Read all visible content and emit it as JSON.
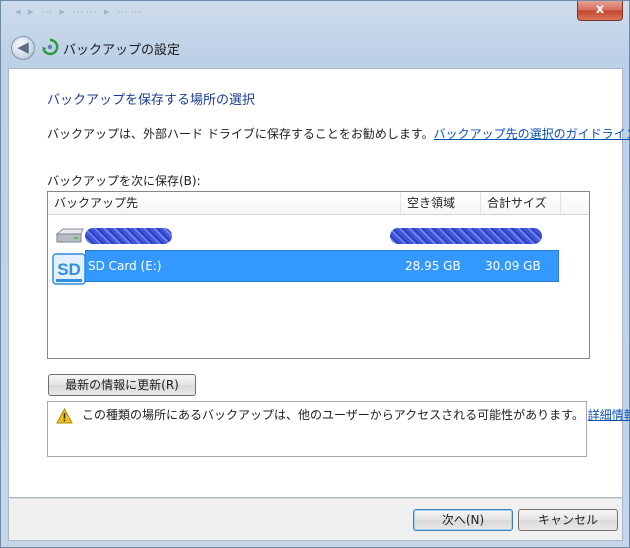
{
  "window": {
    "title": "バックアップの設定",
    "close_glyph": "x",
    "back_glyph": "◀"
  },
  "content": {
    "heading": "バックアップを保存する場所の選択",
    "description": "バックアップは、外部ハード ドライブに保存することをお勧めします。",
    "guideline_link": "バックアップ先の選択のガイドライン",
    "save_label": "バックアップを次に保存(B):"
  },
  "list": {
    "columns": [
      "バックアップ先",
      "空き領域",
      "合計サイズ"
    ],
    "rows": [
      {
        "name": "",
        "free": "",
        "total": "",
        "icon": "hard-drive-icon",
        "redacted": true
      },
      {
        "name": "SD Card (E:)",
        "free": "28.95 GB",
        "total": "30.09 GB",
        "icon": "sd-card-icon",
        "selected": true
      }
    ]
  },
  "refresh_button": "最新の情報に更新(R)",
  "warning": {
    "text": "この種類の場所にあるバックアップは、他のユーザーからアクセスされる可能性があります。",
    "link": "詳細情報",
    "icon": "warning-icon"
  },
  "buttons": {
    "next": "次へ(N)",
    "cancel": "キャンセル"
  },
  "colors": {
    "heading": "#1a3d8f",
    "link": "#0b52b5",
    "selection": "#3399ff",
    "sd_icon": "#2f8fe0"
  }
}
